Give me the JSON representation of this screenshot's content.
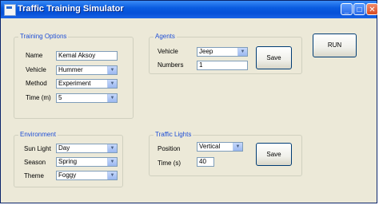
{
  "window": {
    "title": "Traffic Training Simulator"
  },
  "title_buttons": {
    "minimize": "_",
    "maximize": "□",
    "close": "✕"
  },
  "training_options": {
    "legend": "Training Options",
    "name_label": "Name",
    "name_value": "Kemal Aksoy",
    "vehicle_label": "Vehicle",
    "vehicle_value": "Hummer",
    "method_label": "Method",
    "method_value": "Experiment",
    "time_label": "Time (m)",
    "time_value": "5"
  },
  "agents": {
    "legend": "Agents",
    "vehicle_label": "Vehicle",
    "vehicle_value": "Jeep",
    "numbers_label": "Numbers",
    "numbers_value": "1",
    "save_label": "Save"
  },
  "run_button": {
    "label": "RUN"
  },
  "environment": {
    "legend": "Environment",
    "sunlight_label": "Sun Light",
    "sunlight_value": "Day",
    "season_label": "Season",
    "season_value": "Spring",
    "theme_label": "Theme",
    "theme_value": "Foggy"
  },
  "traffic_lights": {
    "legend": "Traffic Lights",
    "position_label": "Position",
    "position_value": "Vertical",
    "time_label": "Time (s)",
    "time_value": "40",
    "save_label": "Save"
  },
  "icons": {
    "dropdown_arrow": "▼"
  }
}
